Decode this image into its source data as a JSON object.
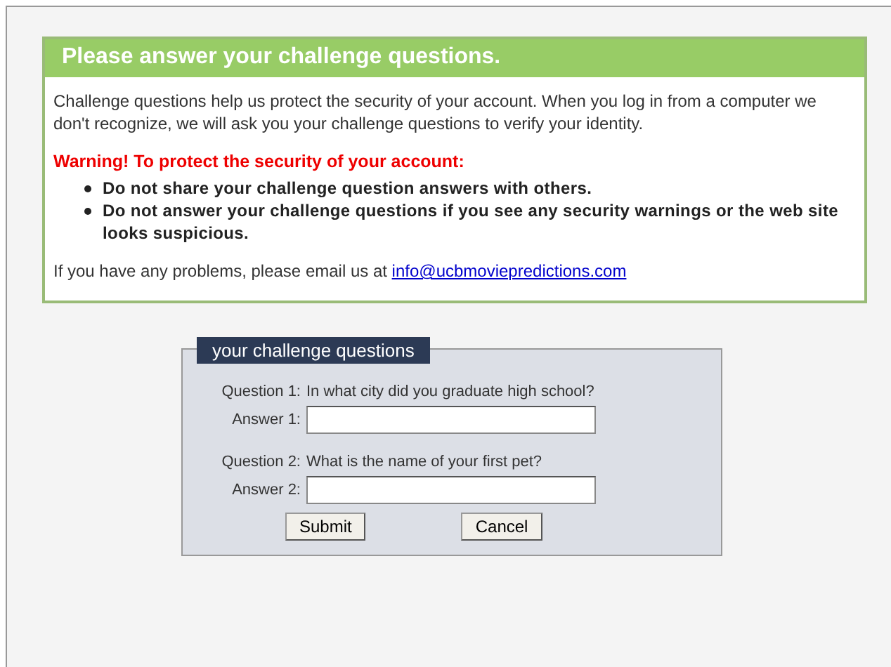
{
  "notice": {
    "title": "Please answer your challenge questions.",
    "intro": "Challenge questions help us protect the security of your account. When you log in from a computer we don't recognize, we will ask you your challenge questions to verify your identity.",
    "warning": "Warning! To protect the security of your account:",
    "bullets": [
      "Do not share your challenge question answers with others.",
      "Do not answer your challenge questions if you see any security warnings or the web site looks suspicious."
    ],
    "contact_text": "If you have any problems, please email us at",
    "contact_link": "info@ucbmoviepredictions.com"
  },
  "form": {
    "legend": "your challenge questions",
    "questions": [
      {
        "label": "Question 1:",
        "question": "In what city did you graduate high school?",
        "answer_label": "Answer 1:"
      },
      {
        "label": "Question 2:",
        "question": "What is the name of your first pet?",
        "answer_label": "Answer 2:"
      }
    ],
    "buttons": [
      "Submit",
      "Cancel"
    ]
  }
}
